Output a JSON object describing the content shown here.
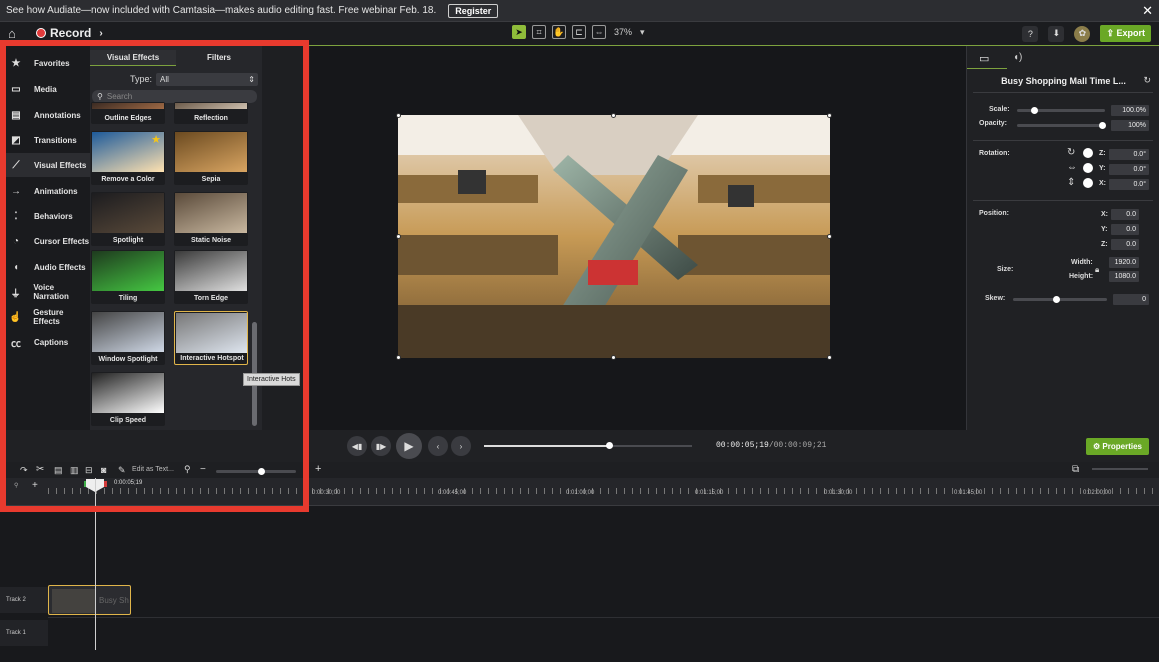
{
  "banner": {
    "text": "See how Audiate—now included with Camtasia—makes audio editing fast. Free webinar Feb. 18.",
    "register": "Register",
    "close": "✕"
  },
  "toolbar": {
    "record_label": "Record",
    "zoom": "37%",
    "export_label": "Export"
  },
  "nav": [
    {
      "label": "Favorites",
      "icon": "star-icon",
      "glyph": "★"
    },
    {
      "label": "Media",
      "icon": "media-icon",
      "glyph": "▭"
    },
    {
      "label": "Annotations",
      "icon": "annotations-icon",
      "glyph": "▤"
    },
    {
      "label": "Transitions",
      "icon": "transitions-icon",
      "glyph": "◩"
    },
    {
      "label": "Visual Effects",
      "icon": "visual-effects-icon",
      "glyph": "⟋"
    },
    {
      "label": "Animations",
      "icon": "animations-icon",
      "glyph": "→"
    },
    {
      "label": "Behaviors",
      "icon": "behaviors-icon",
      "glyph": "⁚"
    },
    {
      "label": "Cursor Effects",
      "icon": "cursor-effects-icon",
      "glyph": "◔"
    },
    {
      "label": "Audio Effects",
      "icon": "audio-effects-icon",
      "glyph": "◖"
    },
    {
      "label": "Voice Narration",
      "icon": "microphone-icon",
      "glyph": "⏚"
    },
    {
      "label": "Gesture Effects",
      "icon": "gesture-icon",
      "glyph": "☝"
    },
    {
      "label": "Captions",
      "icon": "captions-icon",
      "glyph": "㏄"
    }
  ],
  "panel": {
    "tabs": [
      "Visual Effects",
      "Filters"
    ],
    "type_label": "Type:",
    "type_value": "All",
    "search_placeholder": "Search",
    "effects": [
      "Outline Edges",
      "Reflection",
      "Remove a Color",
      "Sepia",
      "Spotlight",
      "Static Noise",
      "Tiling",
      "Torn Edge",
      "Window Spotlight",
      "Interactive Hotspot",
      "Clip Speed"
    ],
    "tooltip": "Interactive Hots"
  },
  "props": {
    "title": "Busy Shopping Mall Time L...",
    "scale_label": "Scale:",
    "scale_value": "100.0%",
    "opacity_label": "Opacity:",
    "opacity_value": "100%",
    "rotation_label": "Rotation:",
    "rot_z_label": "Z:",
    "rot_z": "0.0°",
    "rot_y_label": "Y:",
    "rot_y": "0.0°",
    "rot_x_label": "X:",
    "rot_x": "0.0°",
    "position_label": "Position:",
    "pos_x_label": "X:",
    "pos_x": "0.0",
    "pos_y_label": "Y:",
    "pos_y": "0.0",
    "pos_z_label": "Z:",
    "pos_z": "0.0",
    "size_label": "Size:",
    "width_label": "Width:",
    "width": "1920.0",
    "height_label": "Height:",
    "height": "1080.0",
    "skew_label": "Skew:",
    "skew": "0",
    "properties_button": "Properties"
  },
  "playback": {
    "time_current": "00:00:05;19",
    "time_total": "00:00:09;21",
    "progress": 0.6
  },
  "timeline": {
    "edit_as_text": "Edit as Text...",
    "playhead_time": "0:00:05;19",
    "ticks": [
      "0:00:30;00",
      "0:00:45;00",
      "0:01:00;00",
      "0:01:15;00",
      "0:01:30;00",
      "0:01:45;00",
      "0:02:00;00"
    ],
    "tracks": [
      "Track 2",
      "Track 1"
    ],
    "clip_label": "Busy Sh"
  }
}
